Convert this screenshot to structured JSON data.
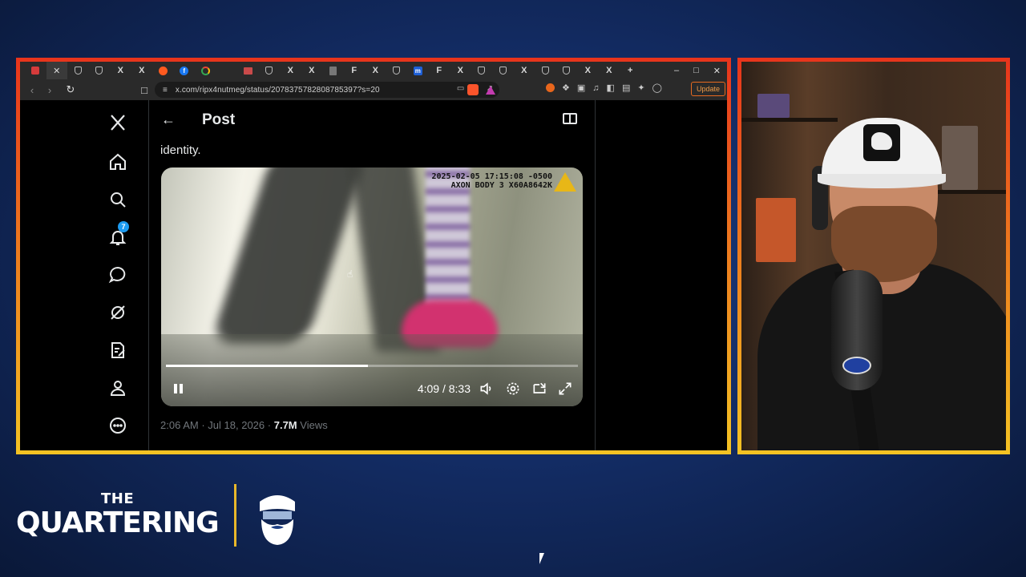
{
  "browser": {
    "tabs": [
      {
        "icon": "red-square-icon",
        "label": ""
      },
      {
        "icon": "close-x-icon",
        "label": "✕"
      },
      {
        "icon": "shield-icon",
        "label": ""
      },
      {
        "icon": "shield-icon",
        "label": ""
      },
      {
        "icon": "x-logo-icon",
        "label": "X"
      },
      {
        "icon": "x-logo-icon",
        "label": "X"
      },
      {
        "icon": "reddit-icon",
        "label": ""
      },
      {
        "icon": "facebook-icon",
        "label": "f"
      },
      {
        "icon": "google-icon",
        "label": ""
      },
      {
        "icon": "",
        "label": ""
      },
      {
        "icon": "picture-icon",
        "label": ""
      },
      {
        "icon": "shield-icon",
        "label": ""
      },
      {
        "icon": "x-logo-icon",
        "label": "X"
      },
      {
        "icon": "x-logo-icon",
        "label": "X"
      },
      {
        "icon": "document-icon",
        "label": ""
      },
      {
        "icon": "f-logo-icon",
        "label": "F"
      },
      {
        "icon": "x-logo-icon",
        "label": "X"
      },
      {
        "icon": "shield-icon",
        "label": ""
      },
      {
        "icon": "m-logo-icon",
        "label": "m"
      },
      {
        "icon": "f-logo-icon",
        "label": "F"
      },
      {
        "icon": "x-logo-icon",
        "label": "X"
      },
      {
        "icon": "shield-icon",
        "label": ""
      },
      {
        "icon": "shield-icon",
        "label": ""
      },
      {
        "icon": "x-logo-icon",
        "label": "X"
      },
      {
        "icon": "shield-icon",
        "label": ""
      },
      {
        "icon": "shield-icon",
        "label": ""
      },
      {
        "icon": "x-logo-icon",
        "label": "X"
      },
      {
        "icon": "x-logo-icon",
        "label": "X"
      },
      {
        "icon": "new-tab-icon",
        "label": "+"
      }
    ],
    "window_controls": {
      "minimize": "–",
      "maximize": "□",
      "close": "✕"
    },
    "url": "x.com/ripx4nutmeg/status/2078375782808785397?s=20",
    "update_label": "Update",
    "accent": "#e86a1f"
  },
  "x_page": {
    "header_title": "Post",
    "nav": {
      "notifications_count": "7",
      "items": [
        "home-icon",
        "search-icon",
        "notifications-icon",
        "messages-icon",
        "grok-icon",
        "drafts-icon",
        "profile-icon",
        "more-icon"
      ]
    },
    "post_text": "identity.",
    "video": {
      "timestamp_line1": "2025-02-05 17:15:08 -0500",
      "timestamp_line2": "AXON BODY 3 X60A8642K",
      "time_display": "4:09 / 8:33",
      "progress_fraction": 0.49
    },
    "meta": {
      "time": "2:06 AM",
      "sep": "·",
      "date": "Jul 18, 2026",
      "views_count": "7.7M",
      "views_label": "Views"
    },
    "link_color": "#1d9bf0"
  },
  "branding": {
    "the": "THE",
    "quartering": "QUARTERING",
    "divider_color": "#e8b72a"
  },
  "frame_gradient": [
    "#e8341c",
    "#ee7d1e",
    "#f4c323"
  ]
}
